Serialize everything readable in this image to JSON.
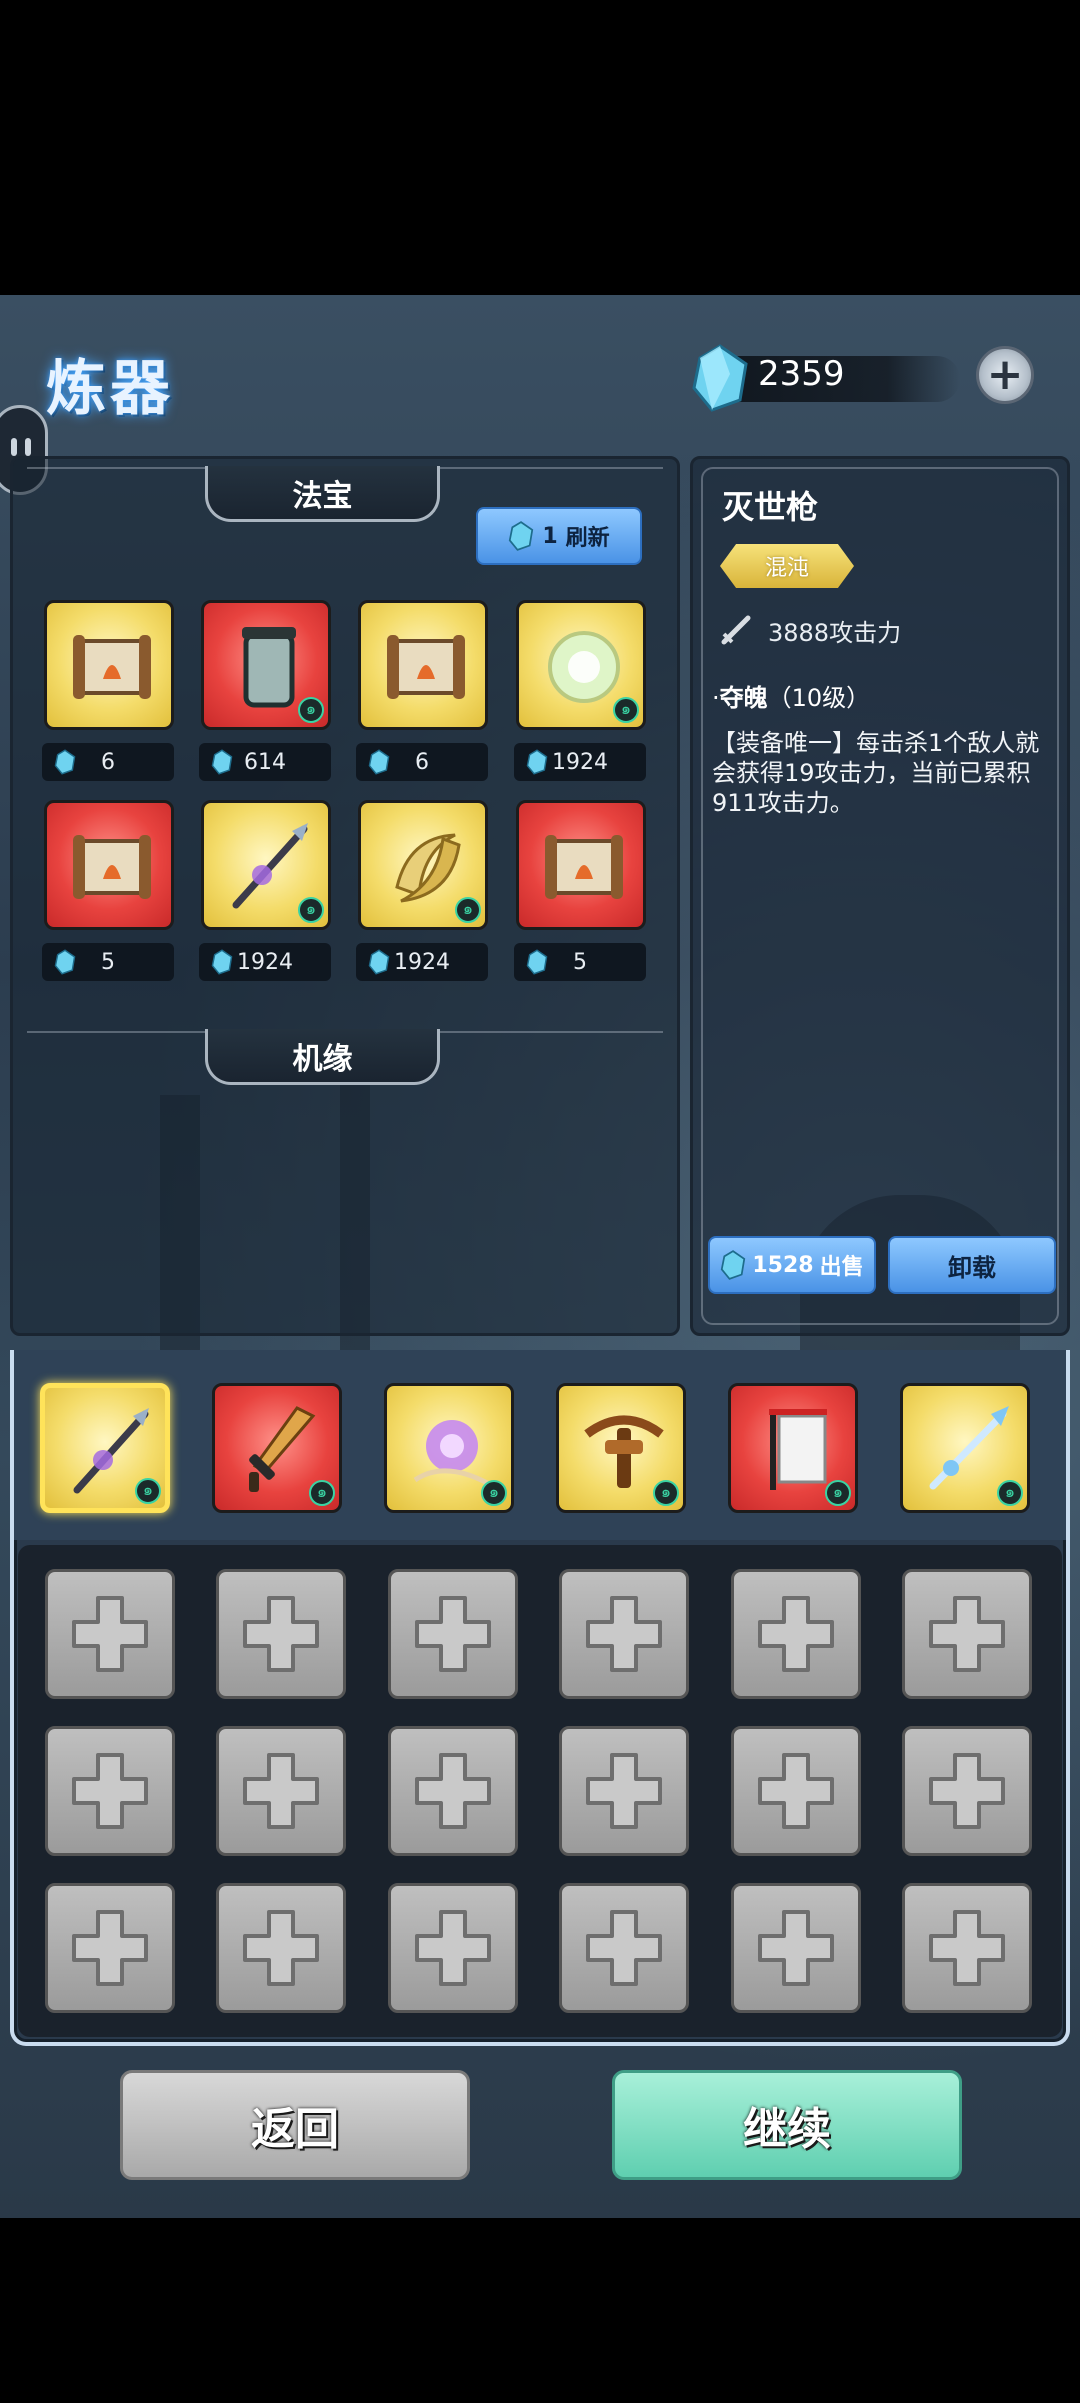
{
  "header": {
    "title": "炼器",
    "currency_value": "2359",
    "add_icon": "plus-icon"
  },
  "shop": {
    "section_title": "法宝",
    "refresh": {
      "cost": "1",
      "label": "刷新"
    },
    "items": [
      {
        "rarity": "yellow",
        "icon": "scroll-icon",
        "price": "6",
        "has_swirl": false
      },
      {
        "rarity": "red",
        "icon": "jar-icon",
        "price": "614",
        "has_swirl": true
      },
      {
        "rarity": "yellow",
        "icon": "scroll-icon",
        "price": "6",
        "has_swirl": false
      },
      {
        "rarity": "yellow",
        "icon": "orb-icon",
        "price": "1924",
        "has_swirl": true
      },
      {
        "rarity": "red",
        "icon": "scroll-icon",
        "price": "5",
        "has_swirl": false
      },
      {
        "rarity": "yellow",
        "icon": "spear-icon",
        "price": "1924",
        "has_swirl": true
      },
      {
        "rarity": "yellow",
        "icon": "crescent-blades-icon",
        "price": "1924",
        "has_swirl": true
      },
      {
        "rarity": "red",
        "icon": "scroll-icon",
        "price": "5",
        "has_swirl": false
      }
    ],
    "fortune_title": "机缘"
  },
  "detail": {
    "name": "灭世枪",
    "quality": "混沌",
    "attack": "3888攻击力",
    "skill_name": "夺魄",
    "skill_level": "（10级）",
    "description": "【装备唯一】每击杀1个敌人就会获得19攻击力，当前已累积911攻击力。",
    "sell_price": "1528",
    "sell_label": "出售",
    "unload_label": "卸载"
  },
  "equipped": [
    {
      "rarity": "yellow",
      "icon": "spear-icon",
      "selected": true
    },
    {
      "rarity": "red",
      "icon": "sword-icon",
      "selected": false
    },
    {
      "rarity": "yellow",
      "icon": "flower-icon",
      "selected": false
    },
    {
      "rarity": "yellow",
      "icon": "crossbow-icon",
      "selected": false
    },
    {
      "rarity": "red",
      "icon": "banner-icon",
      "selected": false
    },
    {
      "rarity": "yellow",
      "icon": "ice-spear-icon",
      "selected": false
    }
  ],
  "empty_slot_rows": 3,
  "empty_slot_cols": 6,
  "footer": {
    "back_label": "返回",
    "continue_label": "继续"
  },
  "colors": {
    "accent_blue": "#4a93e6",
    "continue_teal": "#5fcfb0",
    "yellow_card": "#f4dc6a",
    "red_card": "#e8433f",
    "selected_gold": "#ffe35a"
  }
}
